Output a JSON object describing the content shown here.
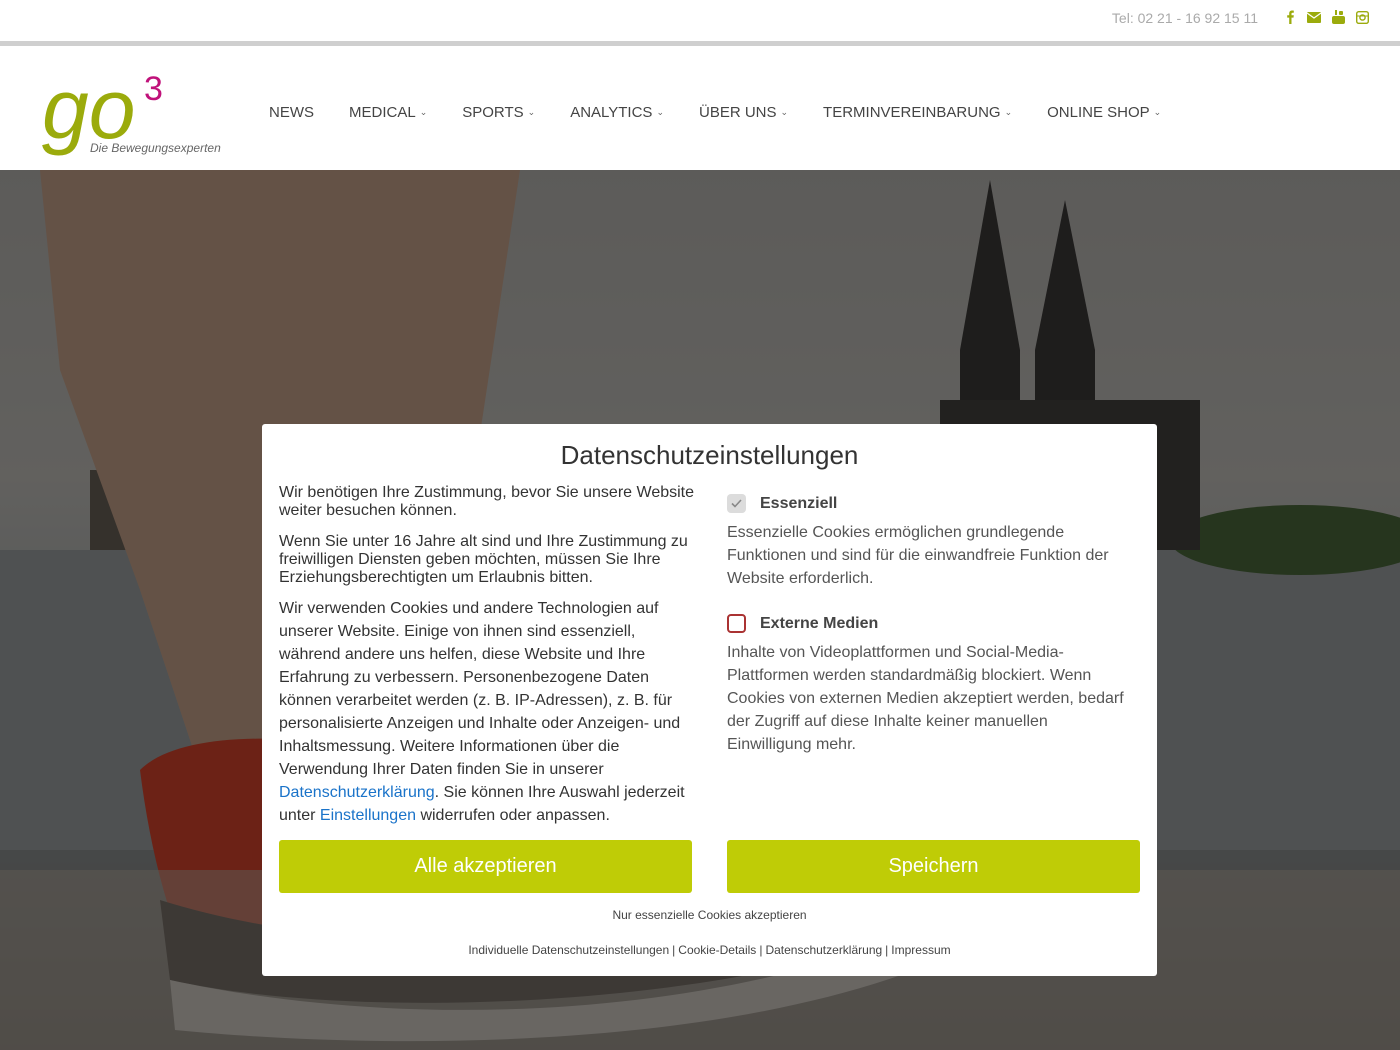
{
  "topbar": {
    "tel": "Tel: 02 21 - 16 92 15 11",
    "social": [
      "facebook-icon",
      "envelope-icon",
      "youtube-icon",
      "instagram-icon"
    ]
  },
  "logo": {
    "main": "go",
    "superscript": "3",
    "tagline": "Die Bewegungsexperten",
    "colors": {
      "green": "#9bab0c",
      "magenta": "#c0127a"
    }
  },
  "nav": {
    "news": "NEWS",
    "medical": "MEDICAL",
    "sports": "SPORTS",
    "analytics": "ANALYTICS",
    "ueber_uns": "ÜBER UNS",
    "termin": "TERMINVEREINBARUNG",
    "shop": "ONLINE SHOP"
  },
  "modal": {
    "title": "Datenschutzeinstellungen",
    "p1": "Wir benötigen Ihre Zustimmung, bevor Sie unsere Website weiter besuchen können.",
    "p2": "Wenn Sie unter 16 Jahre alt sind und Ihre Zustimmung zu freiwilligen Diensten geben möchten, müssen Sie Ihre Erziehungsberechtigten um Erlaubnis bitten.",
    "p3_a": "Wir verwenden Cookies und andere Technologien auf unserer Website. Einige von ihnen sind essenziell, während andere uns helfen, diese Website und Ihre Erfahrung zu verbessern. Personenbezogene Daten können verarbeitet werden (z. B. IP-Adressen), z. B. für personalisierte Anzeigen und Inhalte oder Anzeigen- und Inhaltsmessung. Weitere Informationen über die Verwendung Ihrer Daten finden Sie in unserer ",
    "p3_link1": "Datenschutzerklärung",
    "p3_b": ". Sie können Ihre Auswahl jederzeit unter ",
    "p3_link2": "Einstellungen",
    "p3_c": " widerrufen oder anpassen.",
    "essential": {
      "label": "Essenziell",
      "checked": true,
      "desc": "Essenzielle Cookies ermöglichen grundlegende Funktionen und sind für die einwandfreie Funktion der Website erforderlich."
    },
    "external": {
      "label": "Externe Medien",
      "checked": false,
      "desc": "Inhalte von Videoplattformen und Social-Media-Plattformen werden standardmäßig blockiert. Wenn Cookies von externen Medien akzeptiert werden, bedarf der Zugriff auf diese Inhalte keiner manuellen Einwilligung mehr."
    },
    "accept_all": "Alle akzeptieren",
    "save": "Speichern",
    "only_essential": "Nur essenzielle Cookies akzeptieren",
    "footer": {
      "individual": "Individuelle Datenschutzeinstellungen",
      "cookie_details": "Cookie-Details",
      "privacy": "Datenschutzerklärung",
      "imprint": "Impressum",
      "separator": "|"
    },
    "colors": {
      "button": "#bfcc06",
      "link": "#1a73c9",
      "unchecked_border": "#aa3333"
    }
  }
}
